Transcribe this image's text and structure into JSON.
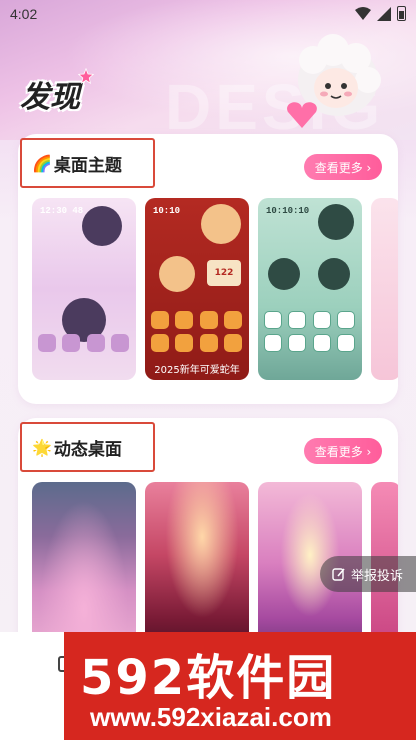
{
  "status_bar": {
    "time": "4:02",
    "icons": [
      "wifi-icon",
      "signal-icon",
      "battery-icon"
    ]
  },
  "header": {
    "title": "发现",
    "watermark_text": "DESIG"
  },
  "sections": [
    {
      "title": "桌面主题",
      "emoji": "🌈",
      "more_label": "查看更多 ›",
      "items": [
        {
          "name": "kuromi-theme",
          "clock": "12:30 48"
        },
        {
          "name": "snake-year-theme",
          "clock": "10:10",
          "badge": "122",
          "caption": "2025新年可爱蛇年"
        },
        {
          "name": "cat-boy-theme",
          "clock": "10:10:10"
        },
        {
          "name": "pink-theme"
        }
      ]
    },
    {
      "title": "动态桌面",
      "emoji": "🌟",
      "more_label": "查看更多 ›",
      "items": [
        {
          "name": "pink-waterfall-castle"
        },
        {
          "name": "sunset-ocean"
        },
        {
          "name": "flower-garden-fountain"
        },
        {
          "name": "pink-forest"
        }
      ]
    }
  ],
  "report_button": {
    "label": "举报投诉"
  },
  "watermark": {
    "line1": "592软件园",
    "line2": "www.592xiazai.com"
  },
  "colors": {
    "accent_pink": "#ff5d9b",
    "highlight_box": "#d94a3a",
    "watermark_red": "#d6271f"
  }
}
